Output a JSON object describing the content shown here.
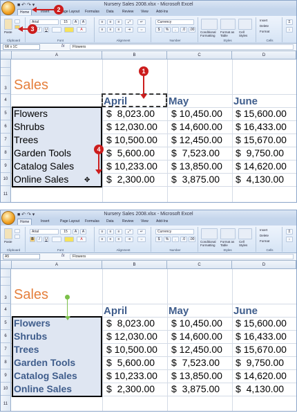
{
  "window": {
    "title": "Nursery Sales 2008.xlsx - Microsoft Excel",
    "qat": "■ ↶ ↷ ▾"
  },
  "ribbon": {
    "tabs": [
      "Home",
      "Insert",
      "Page Layout",
      "Formulas",
      "Data",
      "Review",
      "View",
      "Add-Ins"
    ],
    "groups": {
      "clipboard": "Clipboard",
      "font": "Font",
      "alignment": "Alignment",
      "number": "Number",
      "styles": "Styles",
      "cells": "Cells",
      "editing": "Editing"
    },
    "font_name": "Arial",
    "font_size": "15",
    "number_format": "Currency",
    "paste": "Paste",
    "conditional_formatting": "Conditional Formatting",
    "format_as_table": "Format as Table",
    "cell_styles": "Cell Styles",
    "insert": "Insert",
    "delete": "Delete",
    "format": "Format"
  },
  "top_panel": {
    "name_box": "6R x 1C",
    "formula": "Flowers",
    "callouts": [
      "1",
      "2",
      "3",
      "4"
    ]
  },
  "bottom_panel": {
    "name_box": "A5",
    "formula": "Flowers"
  },
  "sheet": {
    "columns": [
      "A",
      "B",
      "C",
      "D"
    ],
    "row_numbers": [
      "",
      "",
      "3",
      "4",
      "5",
      "6",
      "7",
      "8",
      "9",
      "10",
      "11"
    ],
    "title": "Sales",
    "months": [
      "April",
      "May",
      "June"
    ],
    "categories": [
      "Flowers",
      "Shrubs",
      "Trees",
      "Garden Tools",
      "Catalog Sales",
      "Online Sales"
    ],
    "values": [
      [
        "$  8,023.00",
        "$ 10,450.00",
        "$ 15,600.00"
      ],
      [
        "$ 12,030.00",
        "$ 14,600.00",
        "$ 16,433.00"
      ],
      [
        "$ 10,500.00",
        "$ 12,450.00",
        "$ 15,670.00"
      ],
      [
        "$  5,600.00",
        "$  7,523.00",
        "$  9,750.00"
      ],
      [
        "$ 10,233.00",
        "$ 13,850.00",
        "$ 14,620.00"
      ],
      [
        "$  2,300.00",
        "$  3,875.00",
        "$  4,130.00"
      ]
    ]
  },
  "colors": {
    "title": "#e57f3c",
    "month": "#3f5d8c",
    "category_bold": "#3f5d8c",
    "callout": "#cc1d1d",
    "green_arrow": "#7cc04a"
  }
}
